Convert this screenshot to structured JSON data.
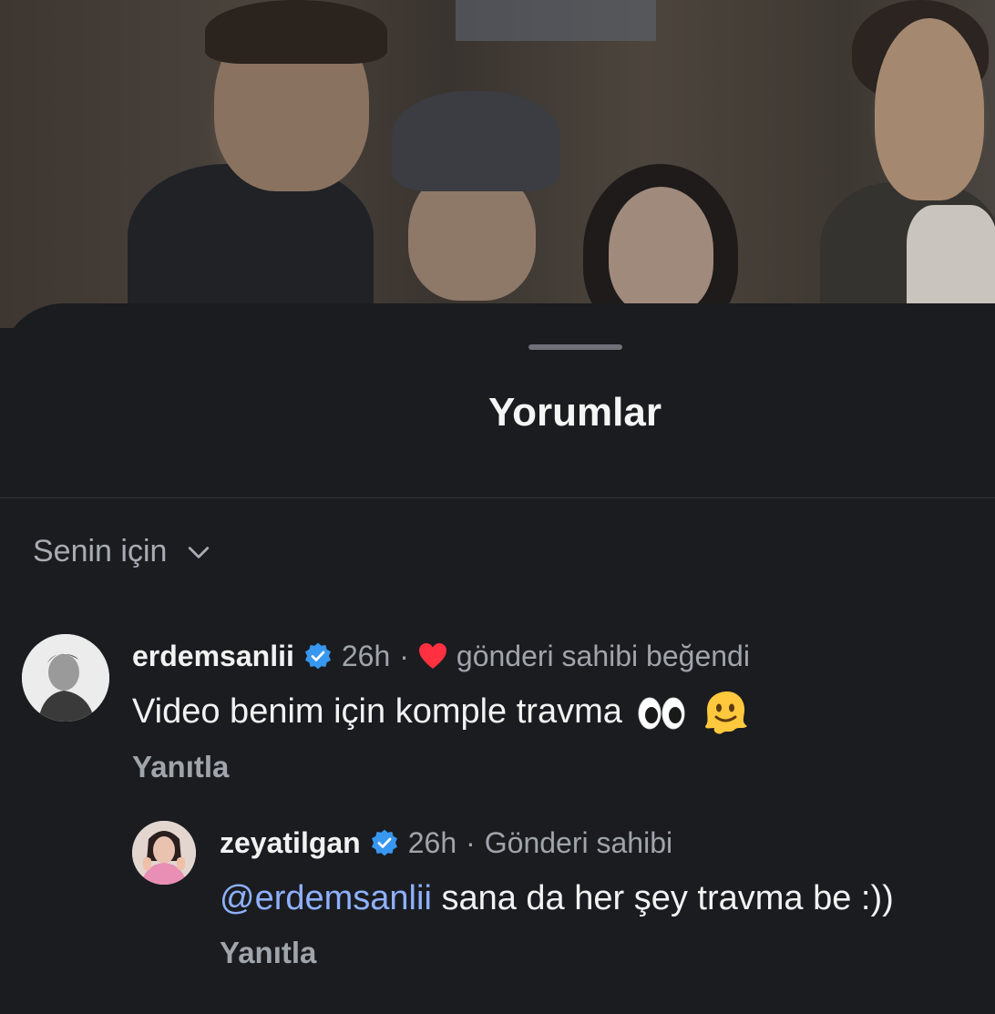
{
  "sheet": {
    "title": "Yorumlar",
    "sort_label": "Senin için"
  },
  "comments": [
    {
      "username": "erdemsanlii",
      "verified": true,
      "time": "26h",
      "liked_by_author_label": "gönderi sahibi beğendi",
      "text": "Video benim için komple travma",
      "emojis": [
        "eyes-emoji",
        "melting-face-emoji"
      ],
      "reply_label": "Yanıtla",
      "replies": [
        {
          "username": "zeyatilgan",
          "verified": true,
          "time": "26h",
          "author_label": "Gönderi sahibi",
          "mention": "@erdemsanlii",
          "text": "sana da her şey travma be :))",
          "reply_label": "Yanıtla"
        }
      ]
    }
  ],
  "colors": {
    "background": "#1a1c20",
    "text_primary": "#f2f2f2",
    "text_secondary": "#a0a4ab",
    "mention": "#8fb0ff",
    "verified": "#3897f0",
    "heart": "#ff3040"
  }
}
